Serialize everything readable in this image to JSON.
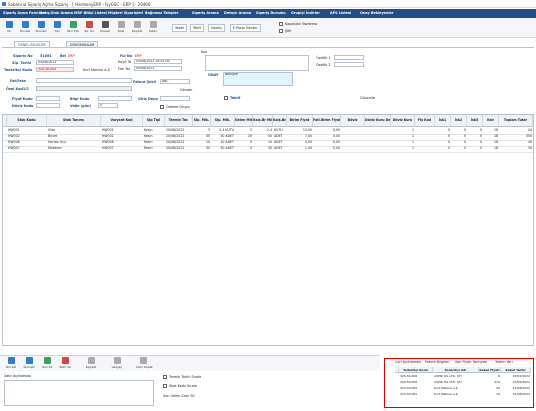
{
  "window": {
    "title": "Sabancıa Sipariş Açma Sipariş - [ HarmonyERP - İşyGSC - ERP ] - 29466"
  },
  "menu": [
    "Sipariş Açma Formları",
    "Satış/Stok Arama",
    "MRP Bitişi Listesi",
    "Müşteri Siparişleri",
    "Bağımsız Talepler",
    "Sipariş Arama",
    "Detaylı Arama",
    "Sipariş Durumu",
    "Grupiçi İndirler",
    "APS Listesi",
    "Onay Bekleyenler"
  ],
  "toolbar": {
    "buttons": [
      {
        "label": "İlk",
        "color": "#2e7bcf"
      },
      {
        "label": "Önceki",
        "color": "#2e7bcf"
      },
      {
        "label": "Sonraki",
        "color": "#2e7bcf"
      },
      {
        "label": "Tipi",
        "color": "#2e7bcf"
      },
      {
        "label": "Yeni Tipi",
        "color": "#3aa35b"
      },
      {
        "label": "Sp. Sil",
        "color": "#d04848"
      },
      {
        "label": "Düzelt",
        "color": "#555"
      },
      {
        "label": "İptal",
        "color": "#888"
      },
      {
        "label": "Kaydet",
        "color": "#888"
      },
      {
        "label": "Yazdır",
        "color": "#888"
      }
    ],
    "text_buttons": [
      "Yazdır",
      "Teklif",
      "Sipariş",
      "E-Posta Gönder"
    ],
    "checks": [
      "Kapatılan Yazdırma",
      "Şifir"
    ]
  },
  "tabs": [
    "GENEL BİLGİLER",
    "DÖKÜMANLAR"
  ],
  "form": {
    "siparis_no_label": "Sipariş No",
    "siparis_no": "51061",
    "bel_label": "Bel",
    "bel_value": "ERP",
    "sip_tarihi_label": "Sip. Tarihi",
    "sip_tarihi": "05/08/2022",
    "teslim_label": "Tedarikçi Kodu",
    "teslim_value": "320.30.005",
    "kurt_value": "Kurt Makine A.Ş",
    "fat_no_label": "Ful No",
    "fat_no": "ERP",
    "kayit_label": "Kayıt Ta",
    "kayit_value": "05/08/2022 16:52:00",
    "kayit_ta_label": "Fatı Tar.",
    "kayit_ta_value": "05/08/2022",
    "fat_adres_label": "Fat/Faks",
    "ozel_kod_label": "Özel Kod1/2",
    "fiyat_label": "Fiyat Kodu",
    "doviz_label": "Döviz Kodu",
    "bilgi_label": "Bilgi Kodu",
    "vade_label": "Vade (gün)",
    "vade_value": "0",
    "fatura_label": "Fatura Şekli",
    "fatura_value": "ABC",
    "gonder_label": "Gönder",
    "gonder_value": "TRY",
    "giris_label": "Giriş Depo",
    "odeme_label": "Ödeme Grupu",
    "not_label": "Not",
    "ozelik1_label": "Özellik 1",
    "ozelik2_label": "Özellik 2",
    "onay_label": "ONAY",
    "onay_value": "Bekliyor",
    "teklif_label": "Teklif",
    "guncelle_label": "Güncelle"
  },
  "grid": {
    "columns": [
      "Stok Kodu",
      "Stok Tanımı",
      "Varyant Kod",
      "Sip.Tipi",
      "Termin Tar.",
      "Sip. Mik.",
      "Sip. Mik.",
      "Gelen Mik.",
      "Kalş.Br Mik.",
      "Kalş.Br.",
      "Birim Fiyat",
      "Fatl.Birim Fiyatı",
      "Döviz",
      "Döviz Kuru Değişik",
      "Döviz Kuru",
      "Fiş Kod",
      "İsk1",
      "İsk2",
      "İsk3",
      "Kdv",
      "Toplam Tutar"
    ],
    "rows": [
      [
        "HW001",
        "Vida",
        "HW001",
        "Kesin",
        "20/08/2022",
        "3",
        "2,4 KUTU",
        "2",
        "2,4",
        "KUTU",
        "10,00",
        "0,00",
        "",
        "",
        "1",
        "",
        "0",
        "0",
        "0",
        "18",
        "24"
      ],
      [
        "HW002",
        "Büvet",
        "HW002",
        "Kesin",
        "20/08/2022",
        "50",
        "50 ADET",
        "20",
        "50",
        "ADET",
        "7,00",
        "0,00",
        "",
        "",
        "1",
        "",
        "0",
        "0",
        "0",
        "18",
        "350"
      ],
      [
        "HW006",
        "Hortan Ucu",
        "HW006",
        "Kesin",
        "20/08/2022",
        "10",
        "10 ADET",
        "0",
        "10",
        "ADET",
        "4,00",
        "0,00",
        "",
        "",
        "1",
        "",
        "0",
        "0",
        "0",
        "18",
        "40"
      ],
      [
        "HW007",
        "Makaron",
        "HW007",
        "Kesin",
        "20/08/2022",
        "30",
        "30 ADET",
        "0",
        "30",
        "ADET",
        "1,00",
        "0,00",
        "",
        "",
        "1",
        "",
        "0",
        "0",
        "0",
        "18",
        "30"
      ]
    ]
  },
  "bottom": {
    "buttons": [
      "Önceki",
      "Sonraki",
      "Yeni Sil",
      "Satır Sil",
      "Kaydet",
      "Vazgeç",
      "Satır Kapat"
    ],
    "aciklama_label": "Satır Açıklaması",
    "checks": [
      "Termin Tarihi Sırala",
      "Stok Kodu Sırala"
    ],
    "son_gelen_label": "Son Gelen Satır Sil"
  },
  "red_panel": {
    "tabs": [
      "Cari Açıklaması",
      "Fatura Bilgileri",
      "Son Fiyatı Tarihçesi",
      "Teslim Yeri"
    ],
    "columns": [
      "Tedarikçi Kodu",
      "Tedarikçi Adı",
      "Kabul Fiyatı",
      "Kabul Tarihi"
    ],
    "rows": [
      [
        "320.30.006",
        "ASPIR OIL LTD. ŞTİ",
        "8",
        "07/02/2022"
      ],
      [
        "320.30.006",
        "ASPIR OIL LTD. ŞTİ",
        "270",
        "27/06/2022"
      ],
      [
        "320.30.005",
        "Kurt Makine A.Ş",
        "10",
        "12/08/2022"
      ],
      [
        "320.30.005",
        "Kurt Makine A.Ş",
        "10",
        "01/08/2022"
      ]
    ]
  }
}
